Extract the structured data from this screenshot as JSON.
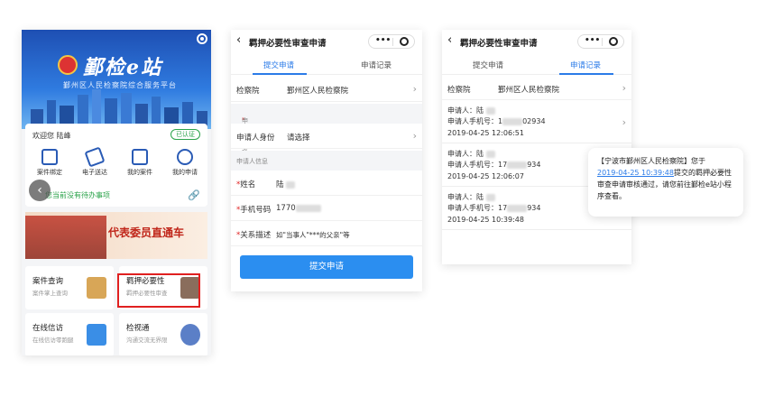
{
  "phone1": {
    "brand": "鄞检e站",
    "brand_sub": "鄞州区人民检察院综合服务平台",
    "welcome": "欢迎您 陆峰",
    "verified": "已认证",
    "quick_items": [
      {
        "label": "案件绑定",
        "icon": "document-icon"
      },
      {
        "label": "电子送达",
        "icon": "ticket-icon"
      },
      {
        "label": "我的案件",
        "icon": "monitor-icon"
      },
      {
        "label": "我的申请",
        "icon": "clock-icon"
      }
    ],
    "todo": "您当前没有待办事项",
    "promo": "代表委员直通车",
    "tiles": [
      {
        "title": "案件查询",
        "sub": "案件掌上查询",
        "color": "#d8a657"
      },
      {
        "title": "羁押必要性",
        "sub": "羁押必要性审查",
        "color": "#8a6d5c"
      },
      {
        "title": "在线信访",
        "sub": "在线信访零跑腿",
        "color": "#3a8ee6"
      },
      {
        "title": "检视通",
        "sub": "沟通交流无界限",
        "color": "#5b7fc7"
      }
    ]
  },
  "phone2": {
    "title": "羁押必要性审查申请",
    "tabs": [
      "提交申请",
      "申请记录"
    ],
    "procuratorate_label": "检察院",
    "procuratorate_value": "鄞州区人民检察院",
    "identity_section": "申请人身份",
    "identity_label": "申请人身份",
    "identity_value": "请选择",
    "info_section": "申请人信息",
    "name_label": "姓名",
    "name_value": "陆",
    "phone_label": "手机号码",
    "phone_value": "1770",
    "relation_label": "关系描述",
    "relation_placeholder": "如\"当事人\"***的父亲\"等",
    "submit": "提交申请"
  },
  "phone3": {
    "title": "羁押必要性审查申请",
    "tabs": [
      "提交申请",
      "申请记录"
    ],
    "procuratorate_label": "检察院",
    "procuratorate_value": "鄞州区人民检察院",
    "records": [
      {
        "name": "申请人：陆",
        "phone": "申请人手机号：1",
        "phone_tail": "02934",
        "time": "2019-04-25 12:06:51"
      },
      {
        "name": "申请人：陆",
        "phone": "申请人手机号：17",
        "phone_tail": "934",
        "time": "2019-04-25 12:06:07"
      },
      {
        "name": "申请人：陆",
        "phone": "申请人手机号：17",
        "phone_tail": "934",
        "time": "2019-04-25 10:39:48"
      }
    ]
  },
  "sms": {
    "prefix": "【宁波市鄞州区人民检察院】您于",
    "link": "2019-04-25 10:39:48",
    "suffix": "提交的羁押必要性审查申请审核通过，请您前往鄞检e站小程序查看。"
  }
}
